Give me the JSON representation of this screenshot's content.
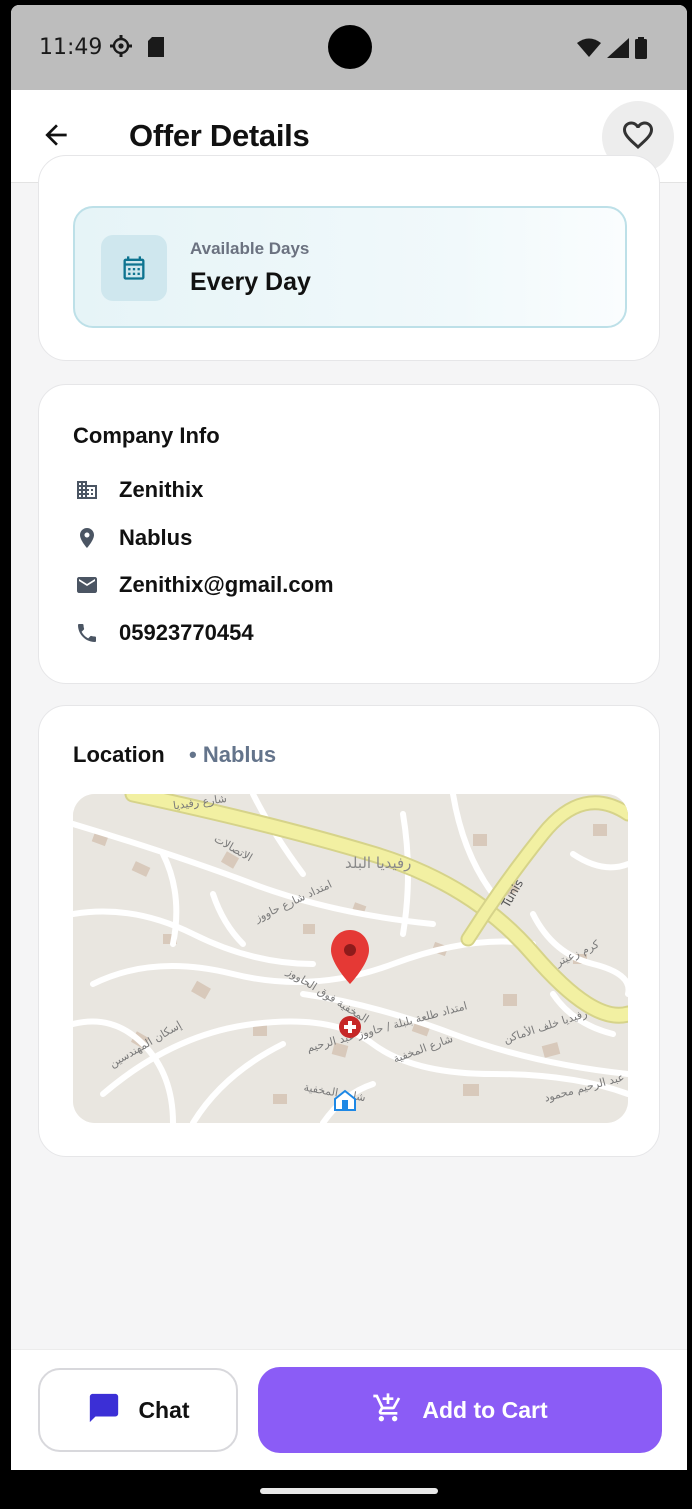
{
  "status_bar": {
    "time": "11:49",
    "icons": [
      "settings-icon",
      "sd-card-icon",
      "wifi-icon",
      "signal-icon",
      "battery-icon"
    ]
  },
  "app_bar": {
    "title": "Offer Details",
    "back_icon": "arrow-left-icon",
    "favorite_icon": "heart-outline-icon"
  },
  "availability": {
    "label": "Available Days",
    "value": "Every Day",
    "icon": "calendar-icon"
  },
  "company_info": {
    "title": "Company Info",
    "name": "Zenithix",
    "city": "Nablus",
    "email": "Zenithix@gmail.com",
    "phone": "05923770454"
  },
  "location": {
    "title": "Location",
    "subtitle": "• Nablus",
    "map_labels": {
      "district": "رفيديا البلد",
      "street_top": "شارع رفيديا",
      "street_tunis": "Tunis",
      "street_1": "الاتصالات",
      "street_2": "امتداد شارع حاووز",
      "street_3": "المخفية فوق الحاووز",
      "street_4": "امتداد طلعة بلبلة / حاووز عبد الرحيم",
      "street_5": "شارع المخفية",
      "street_6": "رفيديا خلف الأماكن",
      "street_7": "إسكان المهندسين",
      "street_8": "شارع المخفية",
      "street_9": "عبد الرحيم محمود",
      "street_10": "كرم زعيتر"
    },
    "pin_color": "#e53935"
  },
  "actions": {
    "chat_label": "Chat",
    "cart_label": "Add to Cart",
    "accent": "#8b5cf6",
    "chat_icon_color": "#3b2fd6"
  }
}
